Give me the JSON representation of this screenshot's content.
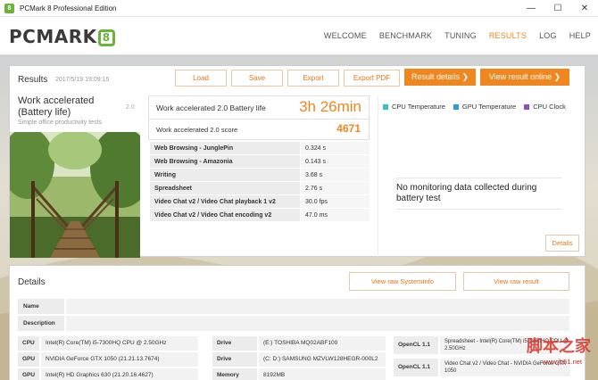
{
  "window": {
    "title": "PCMark 8 Professional Edition",
    "minimize": "—",
    "maximize": "☐",
    "close": "✕"
  },
  "header": {
    "logo_text": "PCMARK",
    "logo_badge": "8",
    "nav": [
      {
        "label": "WELCOME",
        "active": false
      },
      {
        "label": "BENCHMARK",
        "active": false
      },
      {
        "label": "TUNING",
        "active": false
      },
      {
        "label": "RESULTS",
        "active": true
      },
      {
        "label": "LOG",
        "active": false
      },
      {
        "label": "HELP",
        "active": false
      }
    ]
  },
  "results": {
    "title": "Results",
    "date": "2017/5/19 19:09:15",
    "buttons": {
      "load": "Load",
      "save": "Save",
      "export": "Export",
      "export_pdf": "Export PDF",
      "result_details": "Result details",
      "view_online": "View result online"
    },
    "test": {
      "title_line1": "Work accelerated",
      "title_line2": "(Battery life)",
      "version": "2.0",
      "subtitle": "Simple office productivity tests"
    },
    "score": {
      "battery_label": "Work accelerated 2.0 Battery life",
      "battery_value": "3h 26min",
      "score_label": "Work accelerated 2.0 score",
      "score_value": "4671"
    },
    "metrics": [
      {
        "name": "Web Browsing - JunglePin",
        "value": "0.324 s"
      },
      {
        "name": "Web Browsing - Amazonia",
        "value": "0.143 s"
      },
      {
        "name": "Writing",
        "value": "3.68 s"
      },
      {
        "name": "Spreadsheet",
        "value": "2.76 s"
      },
      {
        "name": "Video Chat v2 / Video Chat playback 1 v2",
        "value": "30.0 fps"
      },
      {
        "name": "Video Chat v2 / Video Chat encoding v2",
        "value": "47.0 ms"
      }
    ],
    "monitor": {
      "legend": [
        {
          "label": "CPU Temperature",
          "color": "#3cc0c8"
        },
        {
          "label": "GPU Temperature",
          "color": "#2f9ae0"
        },
        {
          "label": "CPU Clock",
          "color": "#8a4fbf"
        }
      ],
      "message": "No monitoring data collected during battery test",
      "details_button": "Details"
    }
  },
  "details": {
    "title": "Details",
    "view_systeminfo": "View raw SystemInfo",
    "view_result": "View raw result",
    "name_label": "Name",
    "description_label": "Description",
    "system": [
      {
        "l1": "CPU",
        "v1": "Intel(R) Core(TM) i5-7300HQ CPU @ 2.50GHz",
        "l2": "Drive",
        "v2": "(E:) TOSHIBA MQ02ABF100"
      },
      {
        "l1": "GPU",
        "v1": "NVIDIA GeForce GTX 1050 (21.21.13.7674)",
        "l2": "Drive",
        "v2": "(C: D:) SAMSUNG MZVLW128HEGR-000L2"
      },
      {
        "l1": "GPU",
        "v1": "Intel(R) HD Graphics 630 (21.20.16.4627)",
        "l2": "Memory",
        "v2": "8192MB"
      }
    ],
    "opencl": [
      {
        "label": "OpenCL 1.1",
        "value": "Spreadsheet - Intel(R) Core(TM) i5-7300HQ CPU @ 2.50GHz"
      },
      {
        "label": "OpenCL 1.1",
        "value": "Video Chat v2 / Video Chat - NVIDIA GeForce GTX 1050"
      }
    ]
  },
  "watermark": {
    "text": "脚本之家",
    "url": "www.jb51.net"
  }
}
